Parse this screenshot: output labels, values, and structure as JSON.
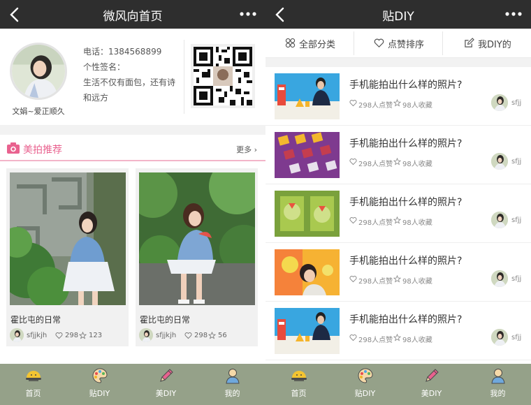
{
  "left": {
    "header": {
      "title": "微风向首页"
    },
    "profile": {
      "name": "文娟~爱正顺久",
      "phone": "电话：1384568899",
      "signature_label": "个性签名：",
      "signature_line1": "生活不仅有面包，还有诗",
      "signature_line2": "和远方"
    },
    "recommend": {
      "title": "美拍推荐",
      "more": "更多"
    },
    "cards": [
      {
        "title": "霍比屯的日常",
        "user": "sfjjkjh",
        "likes": "298",
        "favs": "123"
      },
      {
        "title": "霍比屯的日常",
        "user": "sfjjkjh",
        "likes": "298",
        "favs": "56"
      }
    ]
  },
  "right": {
    "header": {
      "title": "贴DIY"
    },
    "filters": [
      "全部分类",
      "点赞排序",
      "我DIY的"
    ],
    "items": [
      {
        "title": "手机能拍出什么样的照片?",
        "likes": "298人点赞",
        "favs": "98人收藏",
        "user": "sfjj"
      },
      {
        "title": "手机能拍出什么样的照片?",
        "likes": "298人点赞",
        "favs": "98人收藏",
        "user": "sfjj"
      },
      {
        "title": "手机能拍出什么样的照片?",
        "likes": "298人点赞",
        "favs": "98人收藏",
        "user": "sfjj"
      },
      {
        "title": "手机能拍出什么样的照片?",
        "likes": "298人点赞",
        "favs": "98人收藏",
        "user": "sfjj"
      },
      {
        "title": "手机能拍出什么样的照片?",
        "likes": "298人点赞",
        "favs": "98人收藏",
        "user": "sfjj"
      }
    ]
  },
  "tabs": [
    "首页",
    "贴DIY",
    "美DIY",
    "我的"
  ],
  "colors": {
    "header": "#2e2e2e",
    "tabbar": "#95a189",
    "accent_pink": "#e9628f",
    "underline_pink": "#f3b5c9"
  },
  "icons": {
    "header": [
      "back-icon",
      "more-icon"
    ],
    "tabs": [
      "sun-icon",
      "palette-icon",
      "pencil-icon",
      "user-icon"
    ],
    "filters": [
      "grid-icon",
      "heart-icon",
      "edit-icon"
    ]
  }
}
